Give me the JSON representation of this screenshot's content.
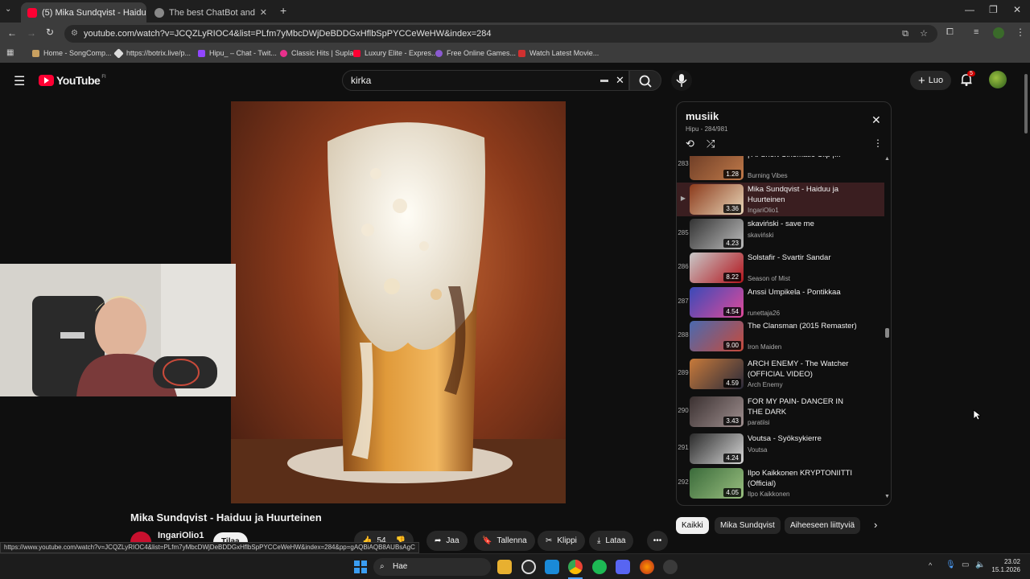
{
  "browser": {
    "tabs": [
      {
        "title": "(5) Mika Sundqvist - Haidu",
        "active": true
      },
      {
        "title": "The best ChatBot and Widgets f",
        "active": false
      }
    ],
    "new_tab": "+",
    "url": "youtube.com/watch?v=JCQZLyRIOC4&list=PLfm7yMbcDWjDeBDDGxHflbSpPYCCeWeHW&index=284",
    "bookmarks": [
      "Home - SongComp...",
      "https://botrix.live/p...",
      "Hipu_ – Chat - Twit...",
      "Classic Hits | Supla",
      "Luxury Elite - Expres...",
      "Free Online Games...",
      "Watch Latest Movie..."
    ],
    "status_url": "https://www.youtube.com/watch?v=JCQZLyRIOC4&list=PLfm7yMbcDWjDeBDDGxHflbSpPYCCeWeHW&index=284&pp=gAQBiAQB8AUBsAgC"
  },
  "youtube": {
    "logo": "YouTube",
    "region": "FI",
    "search_value": "kirka",
    "create_label": "Luo",
    "notif_count": "5"
  },
  "video": {
    "title": "Mika Sundqvist - Haiduu ja Huurteinen",
    "channel": "IngariOlio1",
    "subscribe": "Tilaa",
    "likes": "54",
    "share": "Jaa",
    "save": "Tallenna",
    "clip": "Klippi",
    "download": "Lataa"
  },
  "playlist": {
    "title": "musiik",
    "meta": "Hipu - 284/981",
    "items": [
      {
        "idx": "283",
        "title": "| AI Short Cinematic Clip |...",
        "channel": "Burning Vibes",
        "dur": "1.28",
        "colors": [
          "#6a3a24",
          "#c07a4a"
        ]
      },
      {
        "idx": "▶",
        "title": "Mika Sundqvist - Haiduu ja Huurteinen",
        "channel": "IngariOlio1",
        "dur": "3.36",
        "colors": [
          "#8b3a1b",
          "#e8d6b8"
        ]
      },
      {
        "idx": "285",
        "title": "skaviński - save me",
        "channel": "skaviński",
        "dur": "4.23",
        "colors": [
          "#333333",
          "#bdbdbd"
        ]
      },
      {
        "idx": "286",
        "title": "Solstafir - Svartir Sandar",
        "channel": "Season of Mist",
        "dur": "8.22",
        "colors": [
          "#c8c8c8",
          "#b3141c"
        ]
      },
      {
        "idx": "287",
        "title": "Anssi Umpikela - Pontikkaa",
        "channel": "runettaja26",
        "dur": "4.54",
        "colors": [
          "#3a4ab8",
          "#e04a9a"
        ]
      },
      {
        "idx": "288",
        "title": "The Clansman (2015 Remaster)",
        "channel": "Iron Maiden",
        "dur": "9.00",
        "colors": [
          "#4a6ab0",
          "#c84a3a"
        ]
      },
      {
        "idx": "289",
        "title": "ARCH ENEMY - The Watcher (OFFICIAL VIDEO)",
        "channel": "Arch Enemy",
        "dur": "4.59",
        "colors": [
          "#c87a3a",
          "#2a2a3a"
        ]
      },
      {
        "idx": "290",
        "title": "FOR MY PAIN- DANCER IN THE DARK",
        "channel": "paratiisi",
        "dur": "3.43",
        "colors": [
          "#3a3030",
          "#a09090"
        ]
      },
      {
        "idx": "291",
        "title": "Voutsa - Syöksykierre",
        "channel": "Voutsa",
        "dur": "4.24",
        "colors": [
          "#2a2a2a",
          "#d8d8d8"
        ]
      },
      {
        "idx": "292",
        "title": "Ilpo Kaikkonen KRYPTONIITTI (Official)",
        "channel": "Ilpo Kaikkonen",
        "dur": "4.05",
        "colors": [
          "#3a6a3a",
          "#9ac080"
        ]
      }
    ]
  },
  "chips": [
    "Kaikki",
    "Mika Sundqvist",
    "Aiheeseen liittyviä"
  ],
  "taskbar": {
    "search_label": "Hae",
    "time": "23.02",
    "date": "15.1.2026"
  },
  "colors": {
    "yt_red": "#ff0033",
    "accent_blue": "#3ea6ff"
  }
}
